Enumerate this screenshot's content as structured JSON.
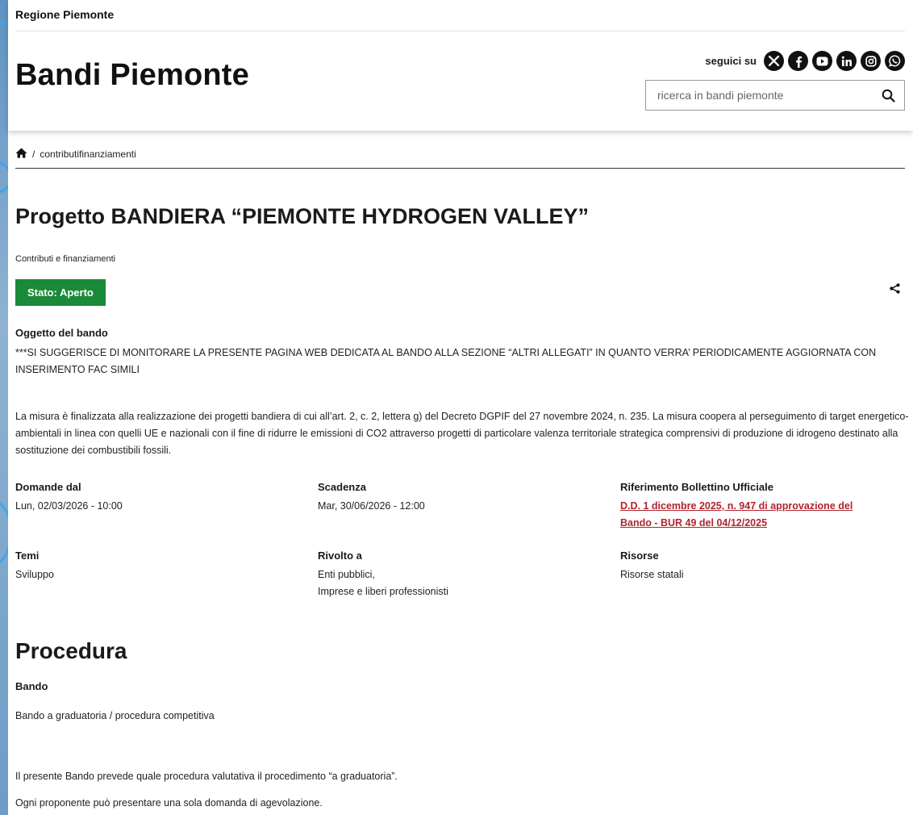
{
  "header": {
    "region": "Regione Piemonte",
    "site_title": "Bandi Piemonte",
    "social_label": "seguici su",
    "social_icons": [
      "x-icon",
      "facebook-icon",
      "youtube-icon",
      "linkedin-icon",
      "instagram-icon",
      "whatsapp-icon"
    ],
    "search_placeholder": "ricerca in bandi piemonte"
  },
  "breadcrumb": {
    "current": "contributifinanziamenti"
  },
  "bando": {
    "title": "Progetto BANDIERA “PIEMONTE HYDROGEN VALLEY”",
    "category": "Contributi e finanziamenti",
    "status": "Stato: Aperto",
    "status_color": "#1a8a38",
    "object_heading": "Oggetto del bando",
    "object_note": "***SI SUGGERISCE DI MONITORARE LA PRESENTE PAGINA WEB DEDICATA AL BANDO ALLA SEZIONE “ALTRI ALLEGATI” IN QUANTO VERRA’ PERIODICAMENTE AGGIORNATA CON INSERIMENTO FAC SIMILI",
    "object_description": "La misura è finalizzata alla realizzazione dei progetti bandiera di cui all’art. 2, c. 2, lettera g) del Decreto DGPIF del 27 novembre 2024, n. 235. La misura coopera al perseguimento di target energetico-ambientali in linea con quelli UE e nazionali con il fine di ridurre le emissioni di CO2 attraverso progetti di particolare valenza territoriale strategica comprensivi di produzione di idrogeno destinato alla sostituzione dei combustibili fossili."
  },
  "info": {
    "domande_label": "Domande dal",
    "domande_value": "Lun, 02/03/2026 - 10:00",
    "scadenza_label": "Scadenza",
    "scadenza_value": "Mar, 30/06/2026 - 12:00",
    "riferimento_label": "Riferimento Bollettino Ufficiale",
    "riferimento_link": "D.D. 1 dicembre 2025, n. 947 di approvazione del Bando - BUR 49 del 04/12/2025",
    "temi_label": "Temi",
    "temi_value": "Sviluppo",
    "rivolto_label": "Rivolto a",
    "rivolto_value_1": "Enti pubblici,",
    "rivolto_value_2": "Imprese e liberi professionisti",
    "risorse_label": "Risorse",
    "risorse_value": "Risorse statali",
    "link_color": "#b0252d"
  },
  "procedura": {
    "title": "Procedura",
    "subtitle": "Bando",
    "type": "Bando a graduatoria / procedura competitiva",
    "text_1": "Il presente Bando prevede quale procedura valutativa il procedimento “a graduatoria”.",
    "text_2": "Ogni proponente può presentare una sola domanda di agevolazione."
  }
}
